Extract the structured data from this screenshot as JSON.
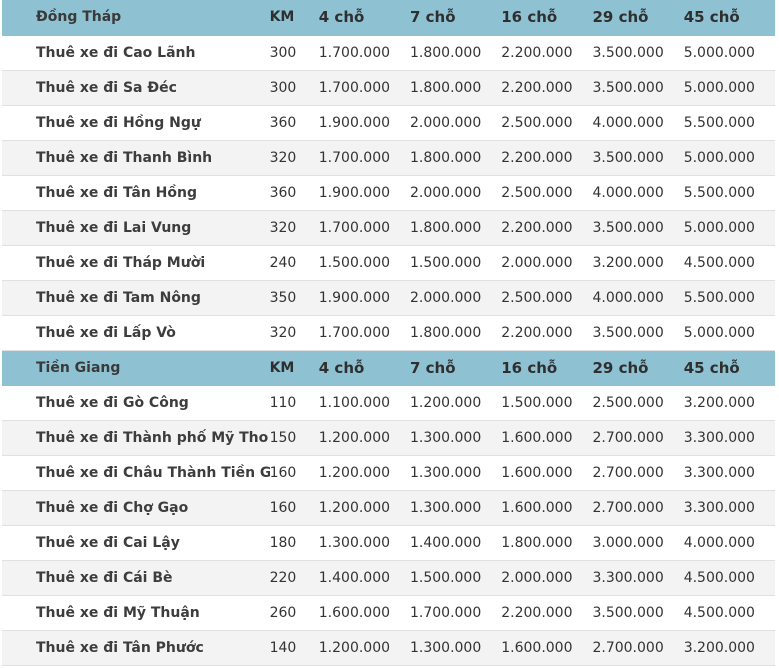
{
  "columns": {
    "km": "KM",
    "seats": [
      "4 chỗ",
      "7 chỗ",
      "16 chỗ",
      "29 chỗ",
      "45 chỗ"
    ]
  },
  "sections": [
    {
      "name": "Đồng Tháp",
      "rows": [
        {
          "route": "Thuê xe đi Cao Lãnh",
          "km": "300",
          "prices": [
            "1.700.000",
            "1.800.000",
            "2.200.000",
            "3.500.000",
            "5.000.000"
          ]
        },
        {
          "route": "Thuê xe đi Sa Đéc",
          "km": "300",
          "prices": [
            "1.700.000",
            "1.800.000",
            "2.200.000",
            "3.500.000",
            "5.000.000"
          ]
        },
        {
          "route": "Thuê xe đi Hồng Ngự",
          "km": "360",
          "prices": [
            "1.900.000",
            "2.000.000",
            "2.500.000",
            "4.000.000",
            "5.500.000"
          ]
        },
        {
          "route": "Thuê xe đi Thanh Bình",
          "km": "320",
          "prices": [
            "1.700.000",
            "1.800.000",
            "2.200.000",
            "3.500.000",
            "5.000.000"
          ]
        },
        {
          "route": "Thuê xe đi Tân Hồng",
          "km": "360",
          "prices": [
            "1.900.000",
            "2.000.000",
            "2.500.000",
            "4.000.000",
            "5.500.000"
          ]
        },
        {
          "route": "Thuê xe đi Lai Vung",
          "km": "320",
          "prices": [
            "1.700.000",
            "1.800.000",
            "2.200.000",
            "3.500.000",
            "5.000.000"
          ]
        },
        {
          "route": "Thuê xe đi Tháp Mười",
          "km": "240",
          "prices": [
            "1.500.000",
            "1.500.000",
            "2.000.000",
            "3.200.000",
            "4.500.000"
          ]
        },
        {
          "route": "Thuê xe đi Tam Nông",
          "km": "350",
          "prices": [
            "1.900.000",
            "2.000.000",
            "2.500.000",
            "4.000.000",
            "5.500.000"
          ]
        },
        {
          "route": "Thuê xe đi Lấp Vò",
          "km": "320",
          "prices": [
            "1.700.000",
            "1.800.000",
            "2.200.000",
            "3.500.000",
            "5.000.000"
          ]
        }
      ]
    },
    {
      "name": "Tiền Giang",
      "rows": [
        {
          "route": "Thuê xe đi Gò Công",
          "km": "110",
          "prices": [
            "1.100.000",
            "1.200.000",
            "1.500.000",
            "2.500.000",
            "3.200.000"
          ]
        },
        {
          "route": "Thuê xe đi Thành phố Mỹ Tho",
          "km": "150",
          "prices": [
            "1.200.000",
            "1.300.000",
            "1.600.000",
            "2.700.000",
            "3.300.000"
          ]
        },
        {
          "route": "Thuê xe đi Châu Thành Tiền Giang",
          "km": "160",
          "prices": [
            "1.200.000",
            "1.300.000",
            "1.600.000",
            "2.700.000",
            "3.300.000"
          ]
        },
        {
          "route": "Thuê xe đi Chợ Gạo",
          "km": "160",
          "prices": [
            "1.200.000",
            "1.300.000",
            "1.600.000",
            "2.700.000",
            "3.300.000"
          ]
        },
        {
          "route": "Thuê xe đi Cai Lậy",
          "km": "180",
          "prices": [
            "1.300.000",
            "1.400.000",
            "1.800.000",
            "3.000.000",
            "4.000.000"
          ]
        },
        {
          "route": "Thuê xe đi Cái Bè",
          "km": "220",
          "prices": [
            "1.400.000",
            "1.500.000",
            "2.000.000",
            "3.300.000",
            "4.500.000"
          ]
        },
        {
          "route": "Thuê xe đi Mỹ Thuận",
          "km": "260",
          "prices": [
            "1.600.000",
            "1.700.000",
            "2.200.000",
            "3.500.000",
            "4.500.000"
          ]
        },
        {
          "route": "Thuê xe đi Tân Phước",
          "km": "140",
          "prices": [
            "1.200.000",
            "1.300.000",
            "1.600.000",
            "2.700.000",
            "3.200.000"
          ]
        }
      ]
    }
  ]
}
